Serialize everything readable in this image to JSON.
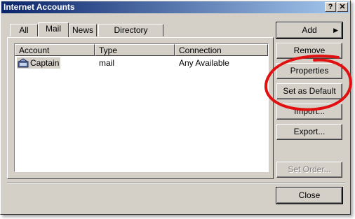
{
  "window": {
    "title": "Internet Accounts",
    "help_label": "?",
    "close_label": "✕"
  },
  "tabs": [
    {
      "label": "All",
      "active": false
    },
    {
      "label": "Mail",
      "active": true
    },
    {
      "label": "News",
      "active": false
    },
    {
      "label": "Directory Service",
      "active": false
    }
  ],
  "list": {
    "columns": [
      "Account",
      "Type",
      "Connection"
    ],
    "rows": [
      {
        "account": "Captain",
        "type": "mail",
        "connection": "Any Available",
        "icon": "mail-account-icon",
        "selected": true
      }
    ]
  },
  "buttons": {
    "add": "Add",
    "remove": "Remove",
    "properties": "Properties",
    "set_default": "Set as Default",
    "import": "Import...",
    "export": "Export...",
    "set_order": "Set Order...",
    "close": "Close"
  },
  "colors": {
    "annotation": "#e01010",
    "titlebar_start": "#0a246a",
    "titlebar_end": "#a6caf0",
    "face": "#d4d0c8"
  }
}
